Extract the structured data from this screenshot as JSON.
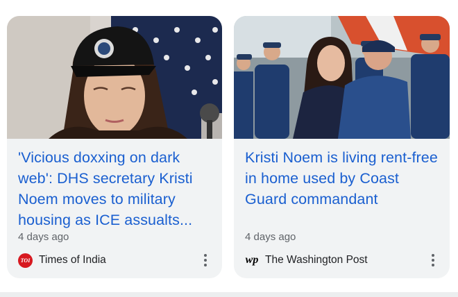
{
  "articles": [
    {
      "headline": "'Vicious doxxing on dark web': DHS secretary Kristi Noem moves to military housing as ICE assualts...",
      "age": "4 days ago",
      "source": "Times of India",
      "source_logo": "TOI",
      "image_icon": "news-photo-woman-cap-flag"
    },
    {
      "headline": "Kristi Noem is living rent-free in home used by Coast Guard commandant",
      "age": "4 days ago",
      "source": "The Washington Post",
      "source_logo": "wp",
      "image_icon": "news-photo-coast-guard"
    }
  ],
  "colors": {
    "headline": "#1a5fd0",
    "card_background": "#f1f3f4",
    "toi_red": "#d71920"
  }
}
